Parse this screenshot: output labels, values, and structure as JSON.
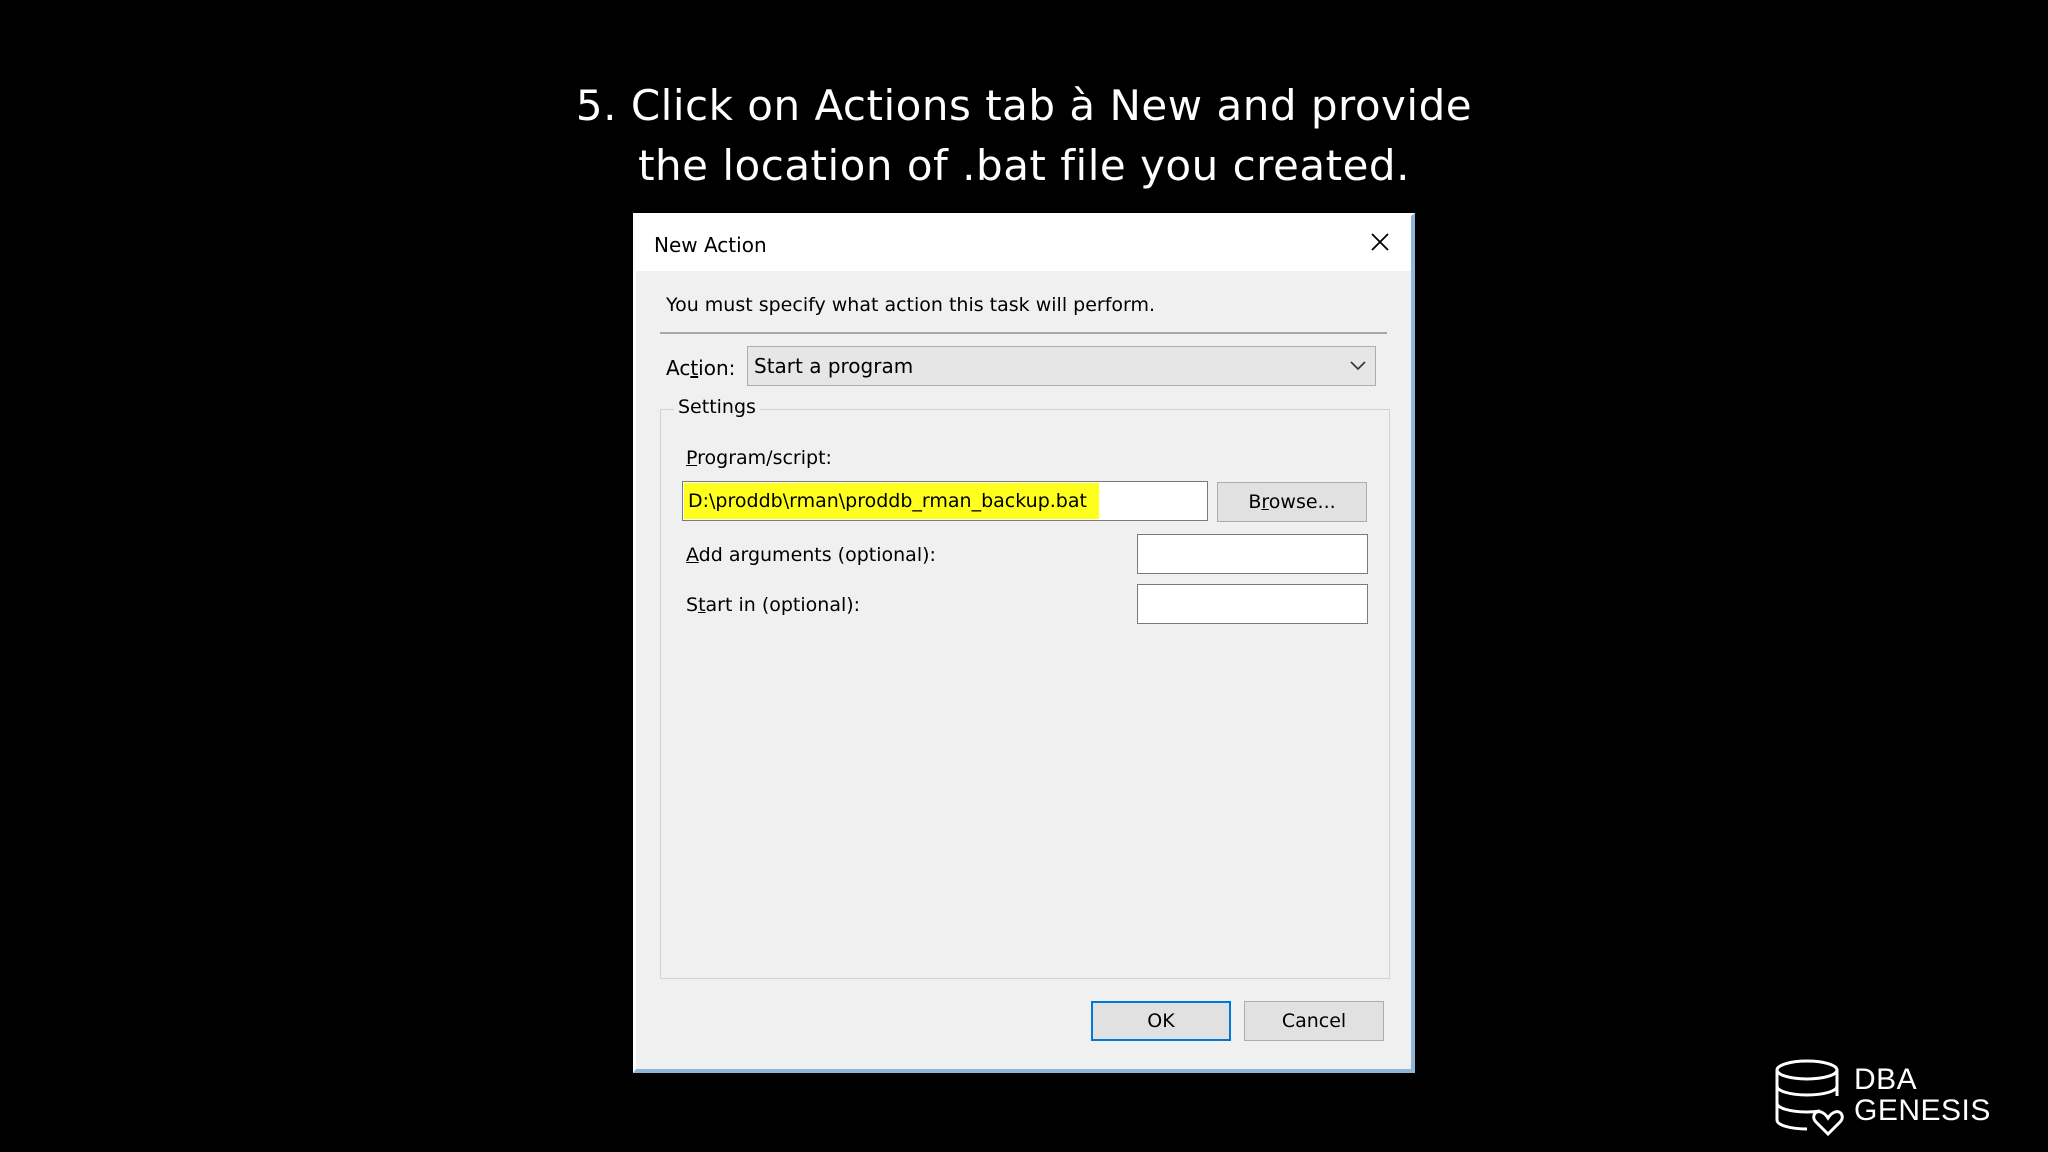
{
  "caption": {
    "line1": "5. Click on Actions tab à New and provide",
    "line2": "the location of .bat file you created."
  },
  "dialog": {
    "title": "New Action",
    "instruction": "You must specify what action this task will perform.",
    "action": {
      "label_pre": "Ac",
      "label_accel": "t",
      "label_post": "ion:",
      "selected_value": "Start a program",
      "chevron_icon": "chevron-down-icon"
    },
    "settings": {
      "legend": "Settings",
      "program": {
        "label_accel": "P",
        "label_post": "rogram/script:",
        "value": "D:\\proddb\\rman\\proddb_rman_backup.bat",
        "highlight_color": "#ffff1e"
      },
      "browse": {
        "label_pre": "B",
        "label_accel": "r",
        "label_post": "owse..."
      },
      "arguments": {
        "label_accel": "A",
        "label_post": "dd arguments (optional):",
        "value": ""
      },
      "start_in": {
        "label_pre": "S",
        "label_accel": "t",
        "label_post": "art in (optional):",
        "value": ""
      }
    },
    "buttons": {
      "ok": "OK",
      "cancel": "Cancel"
    },
    "colors": {
      "ok_focus_border": "#0078d7",
      "dialog_background": "#f0f0f0"
    }
  },
  "logo": {
    "line1": "DBA",
    "line2": "GENESIS",
    "icon": "database-heart-icon"
  }
}
